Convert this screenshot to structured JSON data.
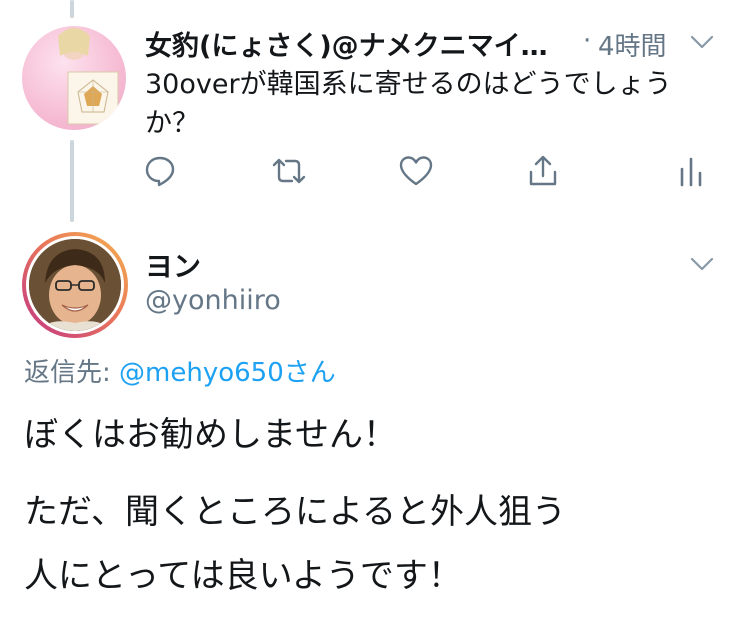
{
  "reply_to_tweet": {
    "display_name": "女豹(にょさく)@ナメクニマイ…",
    "separator": "·",
    "timestamp": "4時間",
    "text_line1": "30overが韓国系に寄せるのはどうでしょう",
    "text_line2": "か？",
    "actions": [
      "reply-icon",
      "retweet-icon",
      "like-icon",
      "share-icon",
      "analytics-icon"
    ]
  },
  "main_tweet": {
    "display_name": "ヨン",
    "handle": "@yonhiiro",
    "reply_prefix": "返信先:",
    "reply_mention": "@mehyo650さん",
    "body_line1": "ぼくはお勧めしません！",
    "body_line2": "ただ、聞くところによると外人狙う",
    "body_line3": "人にとっては良いようです！"
  },
  "colors": {
    "text": "#14171a",
    "secondary": "#657786",
    "link": "#1da1f2",
    "thread_line": "#ccd6dd",
    "icon": "#657786"
  }
}
